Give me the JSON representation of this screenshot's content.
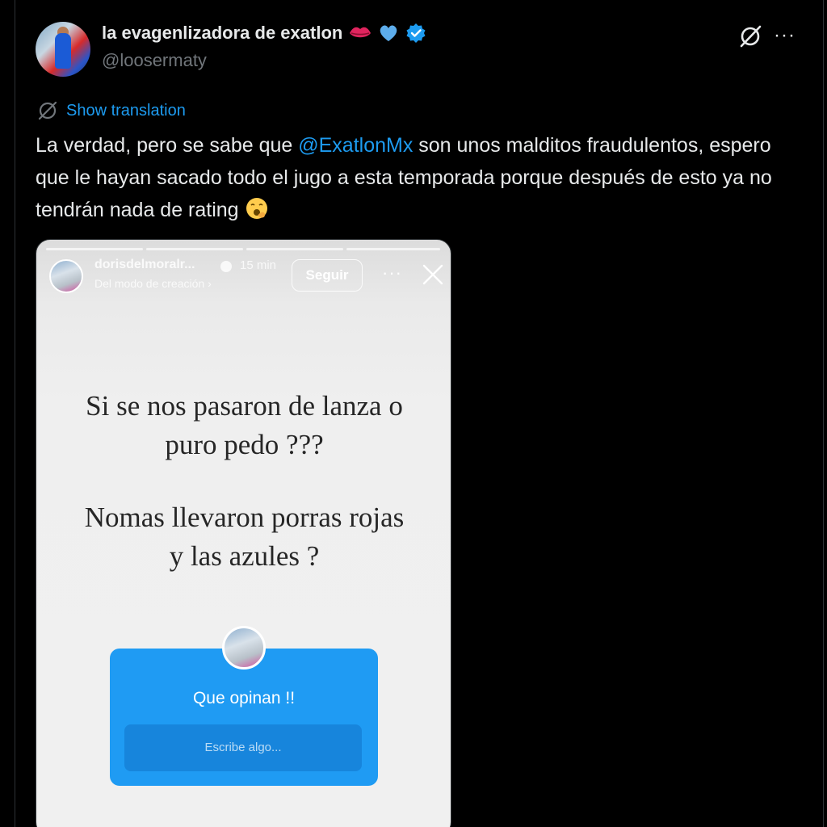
{
  "tweet": {
    "display_name": "la evagenlizadora de exatlon",
    "handle": "@loosermaty",
    "show_translation": "Show translation",
    "text_before": "La verdad, pero se sabe que ",
    "mention": "@ExatlonMx",
    "text_after": " son unos malditos fraudulentos, espero que le hayan sacado todo el jugo a esta temporada porque después de esto ya no tendrán nada de rating",
    "more_label": "···",
    "icons": [
      "lips-emoji",
      "blue-heart-emoji",
      "verified-badge",
      "grok-icon",
      "more-icon",
      "translate-icon",
      "yawning-face-emoji"
    ]
  },
  "story": {
    "username": "dorisdelmoralr...",
    "time": "15 min",
    "subtitle": "Del modo de creación ›",
    "follow_label": "Seguir",
    "more_label": "···",
    "line1": "Si se nos pasaron de lanza o",
    "line2": "puro pedo ???",
    "line3": "Nomas llevaron porras rojas",
    "line4": "y las azules ?",
    "question_title": "Que opinan !!",
    "question_placeholder": "Escribe algo..."
  },
  "colors": {
    "background": "#000000",
    "link": "#1d9bf0",
    "question_box": "#1f9bf3"
  }
}
